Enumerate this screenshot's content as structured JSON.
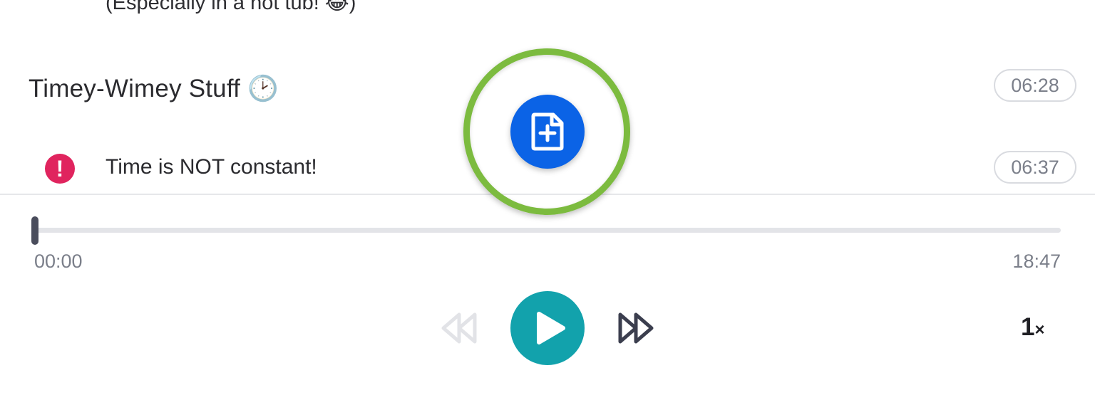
{
  "transcript": {
    "partial_line": "(Especially in a hot tub! 😂)",
    "section_title": "Timey-Wimey Stuff 🕑",
    "section_time": "06:28",
    "note_text": "Time is NOT constant!",
    "note_time": "06:37",
    "note_icon": "exclamation-icon",
    "note_icon_glyph": "!"
  },
  "add_button": {
    "icon": "add-document-icon",
    "accent_color": "#0b63e6",
    "highlight_color": "#7cbb3f"
  },
  "player": {
    "current_time": "00:00",
    "total_time": "18:47",
    "progress": 0,
    "play_icon": "play-icon",
    "rewind_icon": "rewind-icon",
    "forward_icon": "fast-forward-icon",
    "speed_value": "1",
    "speed_suffix": "×",
    "accent_color": "#12a2ac"
  }
}
